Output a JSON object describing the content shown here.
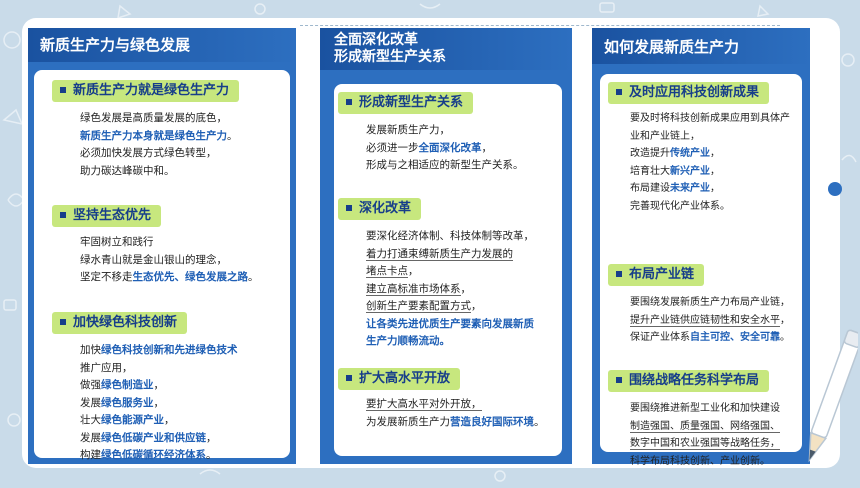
{
  "colors": {
    "panel": "#2d6fc0",
    "tag": "#c7e77e",
    "highlight": "#1f5fb5",
    "text": "#222222"
  },
  "panels": [
    {
      "title": "新质生产力与绿色发展",
      "sections": [
        {
          "heading": "新质生产力就是绿色生产力",
          "lines": [
            [
              {
                "t": "绿色发展是高质量发展的底色，"
              }
            ],
            [
              {
                "t": "新质生产力本身就是绿色生产力",
                "hl": true
              },
              {
                "t": "。"
              }
            ],
            [
              {
                "t": "必须加快发展方式绿色转型，"
              }
            ],
            [
              {
                "t": "助力碳达峰碳中和。"
              }
            ]
          ]
        },
        {
          "heading": "坚持生态优先",
          "lines": [
            [
              {
                "t": "牢固树立和践行"
              }
            ],
            [
              {
                "t": "绿水青山就是金山银山的理念，"
              }
            ],
            [
              {
                "t": "坚定不移走"
              },
              {
                "t": "生态优先、绿色发展之路",
                "hl": true
              },
              {
                "t": "。"
              }
            ]
          ]
        },
        {
          "heading": "加快绿色科技创新",
          "lines": [
            [
              {
                "t": "加快"
              },
              {
                "t": "绿色科技创新和先进绿色技术",
                "hl": true
              }
            ],
            [
              {
                "t": "推广应用，"
              }
            ],
            [
              {
                "t": "做强"
              },
              {
                "t": "绿色制造业",
                "hl": true
              },
              {
                "t": "，"
              }
            ],
            [
              {
                "t": "发展"
              },
              {
                "t": "绿色服务业",
                "hl": true
              },
              {
                "t": "，"
              }
            ],
            [
              {
                "t": "壮大"
              },
              {
                "t": "绿色能源产业",
                "hl": true
              },
              {
                "t": "，"
              }
            ],
            [
              {
                "t": "发展"
              },
              {
                "t": "绿色低碳产业和供应链",
                "hl": true
              },
              {
                "t": "，"
              }
            ],
            [
              {
                "t": "构建"
              },
              {
                "t": "绿色低碳循环经济体系",
                "hl": true
              },
              {
                "t": "。"
              }
            ]
          ]
        }
      ]
    },
    {
      "title_lines": [
        "全面深化改革",
        "形成新型生产关系"
      ],
      "sections": [
        {
          "heading": "形成新型生产关系",
          "lines": [
            [
              {
                "t": "发展新质生产力，"
              }
            ],
            [
              {
                "t": "必须进一步"
              },
              {
                "t": "全面深化改革",
                "hl": true
              },
              {
                "t": "，"
              }
            ],
            [
              {
                "t": "形成与之相适应的新型生产关系。"
              }
            ]
          ]
        },
        {
          "heading": "深化改革",
          "lines": [
            [
              {
                "t": "要深化经济体制、科技体制等改革，"
              }
            ],
            [
              {
                "t": "着力打通束缚新质生产力发展的",
                "u": true
              }
            ],
            [
              {
                "t": "堵点卡点",
                "u": true
              },
              {
                "t": "，"
              }
            ],
            [
              {
                "t": "建立高标准市场体系",
                "u": true
              },
              {
                "t": "，"
              }
            ],
            [
              {
                "t": "创新生产要素配置方式",
                "u": true
              },
              {
                "t": "，"
              }
            ],
            [
              {
                "t": "让各类先进优质生产要素向发展新质",
                "hl": true
              }
            ],
            [
              {
                "t": "生产力顺畅流动。",
                "hl": true
              }
            ]
          ]
        },
        {
          "heading": "扩大高水平开放",
          "lines": [
            [
              {
                "t": "要扩大高水平对外开放，",
                "u": true
              }
            ],
            [
              {
                "t": "为发展新质生产力"
              },
              {
                "t": "营造良好国际环境",
                "hl": true
              },
              {
                "t": "。"
              }
            ]
          ]
        }
      ]
    },
    {
      "title": "如何发展新质生产力",
      "sections": [
        {
          "heading": "及时应用科技创新成果",
          "lines": [
            [
              {
                "t": "要及时将科技创新成果应用到具体产"
              }
            ],
            [
              {
                "t": "业和产业链上，"
              }
            ],
            [
              {
                "t": "改造提升"
              },
              {
                "t": "传统产业",
                "hl": true
              },
              {
                "t": "，"
              }
            ],
            [
              {
                "t": "培育壮大"
              },
              {
                "t": "新兴产业",
                "hl": true
              },
              {
                "t": "，"
              }
            ],
            [
              {
                "t": "布局建设"
              },
              {
                "t": "未来产业",
                "hl": true
              },
              {
                "t": "，"
              }
            ],
            [
              {
                "t": "完善现代化产业体系。"
              }
            ]
          ]
        },
        {
          "heading": "布局产业链",
          "lines": [
            [
              {
                "t": "要围绕发展新质生产力布局产业链，"
              }
            ],
            [
              {
                "t": "提升产业链供应链韧性和安全水平",
                "u": true
              },
              {
                "t": "，"
              }
            ],
            [
              {
                "t": "保证产业体系"
              },
              {
                "t": "自主可控、安全可靠",
                "hl": true
              },
              {
                "t": "。"
              }
            ]
          ]
        },
        {
          "heading": "围绕战略任务科学布局",
          "lines": [
            [
              {
                "t": "要围绕推进新型工业化和加快建设"
              }
            ],
            [
              {
                "t": "制造强国、质量强国、网络强国、",
                "u": true
              }
            ],
            [
              {
                "t": "数字中国和农业强国等战略任务，",
                "u": true
              }
            ],
            [
              {
                "t": "科学布局科技创新、产业创新。"
              }
            ]
          ]
        }
      ]
    }
  ]
}
